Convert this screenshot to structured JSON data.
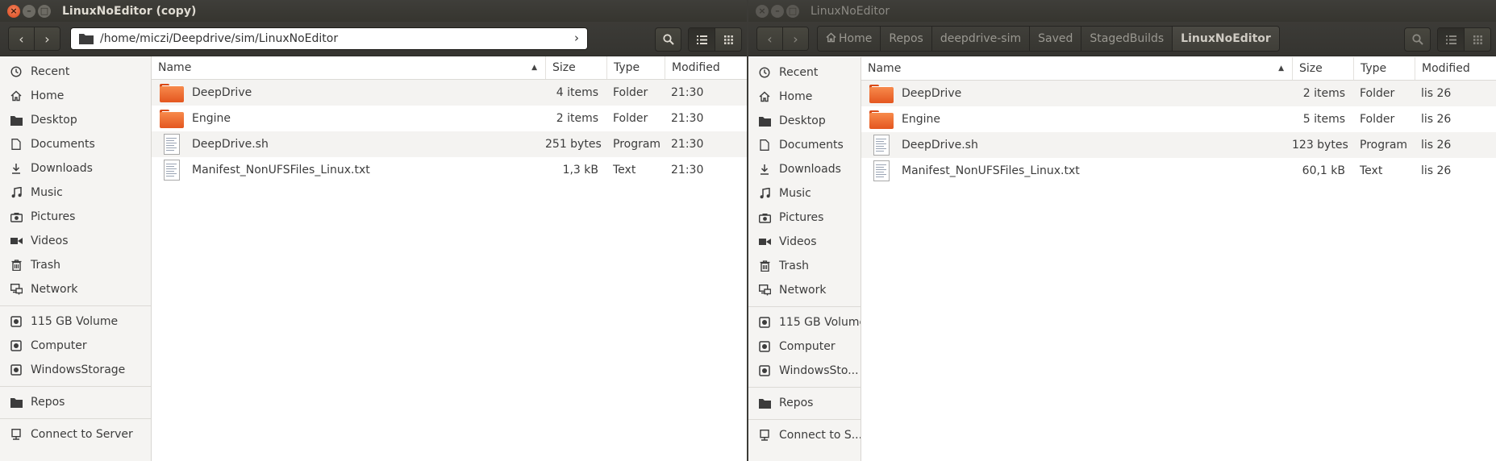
{
  "left": {
    "title": "LinuxNoEditor (copy)",
    "path": "/home/miczi/Deepdrive/sim/LinuxNoEditor",
    "columns": [
      "Name",
      "Size",
      "Type",
      "Modified"
    ],
    "files": [
      {
        "name": "DeepDrive",
        "size": "4 items",
        "type": "Folder",
        "modified": "21:30",
        "icon": "folder-icon"
      },
      {
        "name": "Engine",
        "size": "2 items",
        "type": "Folder",
        "modified": "21:30",
        "icon": "folder-icon"
      },
      {
        "name": "DeepDrive.sh",
        "size": "251 bytes",
        "type": "Program",
        "modified": "21:30",
        "icon": "script-file-icon"
      },
      {
        "name": "Manifest_NonUFSFiles_Linux.txt",
        "size": "1,3 kB",
        "type": "Text",
        "modified": "21:30",
        "icon": "text-file-icon"
      }
    ],
    "sidebar": [
      "Recent",
      "Home",
      "Desktop",
      "Documents",
      "Downloads",
      "Music",
      "Pictures",
      "Videos",
      "Trash",
      "Network"
    ],
    "devices": [
      "115 GB Volume",
      "Computer",
      "WindowsStorage"
    ],
    "bookmarks": [
      "Repos"
    ],
    "connect": "Connect to Server"
  },
  "right": {
    "title": "LinuxNoEditor",
    "breadcrumbs": [
      "Home",
      "Repos",
      "deepdrive-sim",
      "Saved",
      "StagedBuilds",
      "LinuxNoEditor"
    ],
    "columns": [
      "Name",
      "Size",
      "Type",
      "Modified"
    ],
    "files": [
      {
        "name": "DeepDrive",
        "size": "2 items",
        "type": "Folder",
        "modified": "lis 26",
        "icon": "folder-icon"
      },
      {
        "name": "Engine",
        "size": "5 items",
        "type": "Folder",
        "modified": "lis 26",
        "icon": "folder-icon"
      },
      {
        "name": "DeepDrive.sh",
        "size": "123 bytes",
        "type": "Program",
        "modified": "lis 26",
        "icon": "script-file-icon"
      },
      {
        "name": "Manifest_NonUFSFiles_Linux.txt",
        "size": "60,1 kB",
        "type": "Text",
        "modified": "lis 26",
        "icon": "text-file-icon"
      }
    ],
    "sidebar": [
      "Recent",
      "Home",
      "Desktop",
      "Documents",
      "Downloads",
      "Music",
      "Pictures",
      "Videos",
      "Trash",
      "Network"
    ],
    "devices": [
      "115 GB Volume",
      "Computer",
      "WindowsSto..."
    ],
    "bookmarks": [
      "Repos"
    ],
    "connect": "Connect to S..."
  },
  "sidebar_icons": [
    "clock-icon",
    "home-icon",
    "folder-icon",
    "document-icon",
    "download-icon",
    "music-icon",
    "camera-icon",
    "video-icon",
    "trash-icon",
    "network-icon"
  ],
  "device_icons": [
    "drive-icon",
    "computer-icon",
    "drive-icon"
  ],
  "colors": {
    "titlebar": "#3c3b37",
    "close": "#e95420",
    "folder": "#f07746"
  }
}
